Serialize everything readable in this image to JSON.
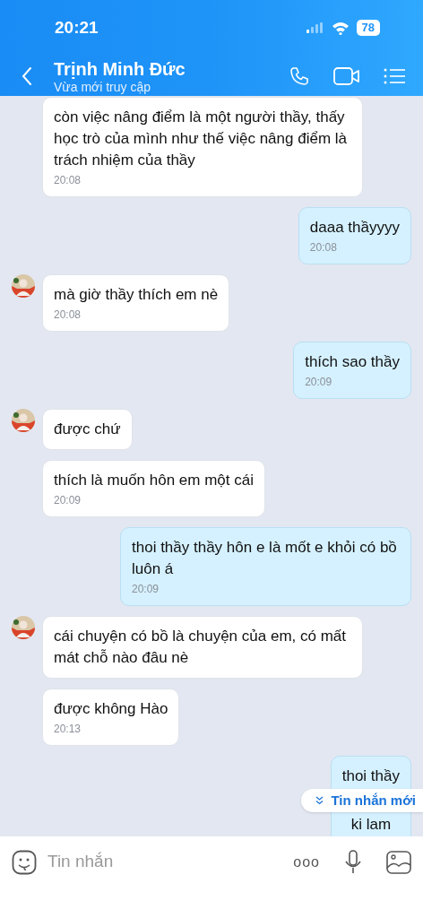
{
  "status_bar": {
    "time": "20:21",
    "battery": "78"
  },
  "header": {
    "name": "Trịnh Minh Đức",
    "status": "Vừa mới truy cập"
  },
  "messages": [
    {
      "kind": "incoming",
      "avatar": false,
      "text": "còn việc nâng điểm là một người thầy, thấy học trò của mình như thế việc nâng điểm là trách nhiệm của thầy",
      "time": "20:08"
    },
    {
      "kind": "outgoing",
      "avatar": false,
      "text": "daaa thầyyyy",
      "time": "20:08"
    },
    {
      "kind": "incoming",
      "avatar": true,
      "text": "mà giờ thầy thích em nè",
      "time": "20:08"
    },
    {
      "kind": "outgoing",
      "avatar": false,
      "text": "thích sao thầy",
      "time": "20:09"
    },
    {
      "kind": "incoming",
      "avatar": true,
      "text": "được chứ"
    },
    {
      "kind": "incoming",
      "avatar": false,
      "text": "thích là muốn hôn em một cái",
      "time": "20:09"
    },
    {
      "kind": "outgoing",
      "avatar": false,
      "text": "thoi thầy thầy hôn e là mốt e khỏi có bồ luôn á",
      "time": "20:09"
    },
    {
      "kind": "incoming",
      "avatar": true,
      "text": "cái chuyện có bồ là chuyện của em, có mất mát chỗ nào đâu nè"
    },
    {
      "kind": "incoming",
      "avatar": false,
      "text": "được không Hào",
      "time": "20:13"
    },
    {
      "kind": "outgoing",
      "text": "thoi thầy",
      "text_2": "ki lam"
    }
  ],
  "new_messages_badge": "Tin nhắn mới",
  "composer": {
    "placeholder": "Tin nhắn",
    "more": "ooo"
  }
}
